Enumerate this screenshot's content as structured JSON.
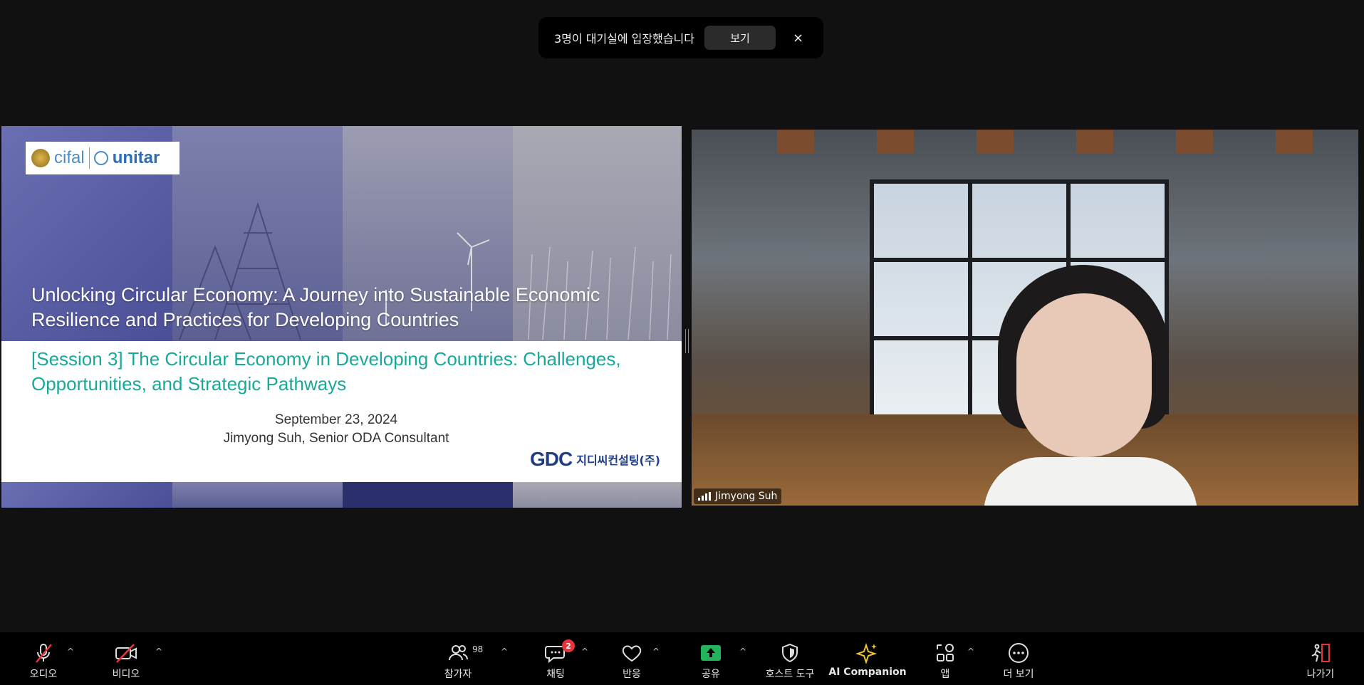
{
  "notification": {
    "message": "3명이 대기실에 입장했습니다",
    "view_label": "보기",
    "close_glyph": "×"
  },
  "slide": {
    "logo_left": {
      "cifal": "cifal",
      "unitar": "unitar"
    },
    "title": "Unlocking Circular Economy: A Journey into Sustainable Economic Resilience and Practices for Developing Countries",
    "session": "[Session 3] The Circular Economy in Developing Countries: Challenges, Opportunities, and Strategic Pathways",
    "date": "September 23, 2024",
    "presenter": "Jimyong Suh, Senior ODA Consultant",
    "logo_right": {
      "mark": "GDC",
      "korean": "지디씨컨설팅(주)"
    }
  },
  "video": {
    "participant_name": "Jimyong Suh"
  },
  "toolbar": {
    "audio_label": "오디오",
    "video_label": "비디오",
    "participants_label": "참가자",
    "participants_count": "98",
    "chat_label": "채팅",
    "chat_badge": "2",
    "reactions_label": "반응",
    "share_label": "공유",
    "host_tools_label": "호스트 도구",
    "ai_companion_label": "AI Companion",
    "apps_label": "앱",
    "more_label": "더 보기",
    "leave_label": "나가기",
    "caret": "^"
  },
  "colors": {
    "share_green": "#22b35c",
    "ai_yellow": "#f2c230",
    "leave_red": "#e8353c",
    "session_teal": "#18a99a"
  }
}
